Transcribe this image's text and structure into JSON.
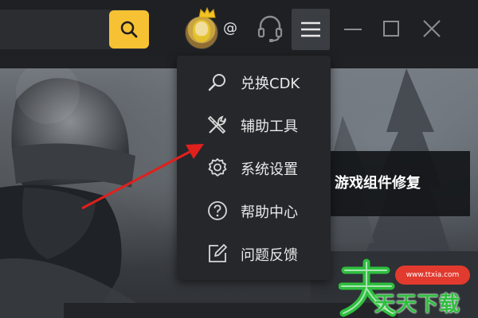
{
  "header": {
    "search": {
      "value": "",
      "placeholder": "",
      "button_icon": "search-icon"
    },
    "avatar_icon": "crown-icon",
    "at_symbol": "@",
    "support_icon": "headset-icon",
    "menu_icon": "hamburger-icon",
    "window_controls": [
      "minimize-icon",
      "maximize-icon",
      "close-icon"
    ]
  },
  "menu": {
    "items": [
      {
        "icon": "search-icon",
        "label": "兑换CDK"
      },
      {
        "icon": "tools-icon",
        "label": "辅助工具"
      },
      {
        "icon": "gear-icon",
        "label": "系统设置"
      },
      {
        "icon": "help-icon",
        "label": "帮助中心"
      },
      {
        "icon": "feedback-icon",
        "label": "问题反馈"
      }
    ]
  },
  "banner": {
    "repair_label": "游戏组件修复"
  },
  "watermark": {
    "logo_text": "天天下载",
    "url": "www.ttxia.com"
  },
  "colors": {
    "accent": "#f6c233",
    "arrow": "#e0201c",
    "menu_bg": "#25272b"
  }
}
